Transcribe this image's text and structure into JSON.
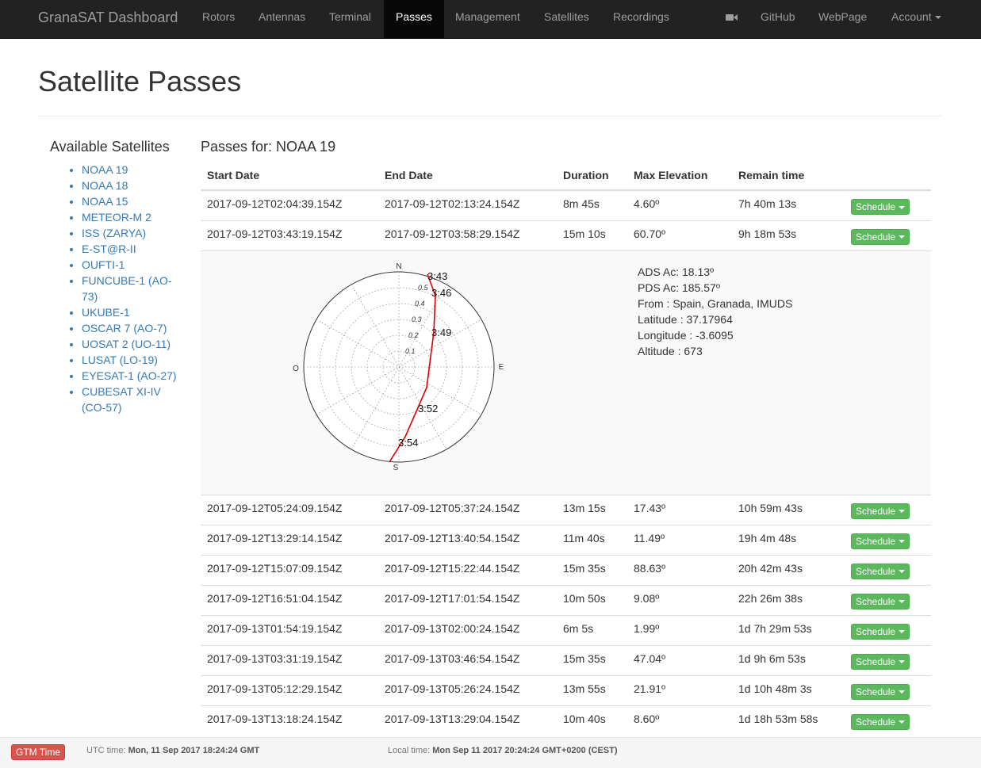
{
  "navbar": {
    "brand": "GranaSAT Dashboard",
    "items": [
      "Rotors",
      "Antennas",
      "Terminal",
      "Passes",
      "Management",
      "Satellites",
      "Recordings"
    ],
    "active": "Passes",
    "camera_icon": "video-camera-icon",
    "right_items": [
      "GitHub",
      "WebPage"
    ],
    "account": "Account"
  },
  "page": {
    "title": "Satellite Passes"
  },
  "sidebar": {
    "title": "Available Satellites",
    "satellites": [
      "NOAA 19",
      "NOAA 18",
      "NOAA 15",
      "METEOR-M 2",
      "ISS (ZARYA)",
      "E-ST@R-II",
      "OUFTI-1",
      "FUNCUBE-1 (AO-73)",
      "UKUBE-1",
      "OSCAR 7 (AO-7)",
      "UOSAT 2 (UO-11)",
      "LUSAT (LO-19)",
      "EYESAT-1 (AO-27)",
      "CUBESAT XI-IV (CO-57)"
    ]
  },
  "main": {
    "title": "Passes for: NOAA 19",
    "columns": [
      "Start Date",
      "End Date",
      "Duration",
      "Max Elevation",
      "Remain time"
    ],
    "schedule_label": "Schedule",
    "rows_before": [
      [
        "2017-09-12T02:04:39.154Z",
        "2017-09-12T02:13:24.154Z",
        "8m 45s",
        "4.60º",
        "7h 40m 13s"
      ],
      [
        "2017-09-12T03:43:19.154Z",
        "2017-09-12T03:58:29.154Z",
        "15m 10s",
        "60.70º",
        "9h 18m 53s"
      ]
    ],
    "rows_after": [
      [
        "2017-09-12T05:24:09.154Z",
        "2017-09-12T05:37:24.154Z",
        "13m 15s",
        "17.43º",
        "10h 59m 43s"
      ],
      [
        "2017-09-12T13:29:14.154Z",
        "2017-09-12T13:40:54.154Z",
        "11m 40s",
        "11.49º",
        "19h 4m 48s"
      ],
      [
        "2017-09-12T15:07:09.154Z",
        "2017-09-12T15:22:44.154Z",
        "15m 35s",
        "88.63º",
        "20h 42m 43s"
      ],
      [
        "2017-09-12T16:51:04.154Z",
        "2017-09-12T17:01:54.154Z",
        "10m 50s",
        "9.08º",
        "22h 26m 38s"
      ],
      [
        "2017-09-13T01:54:19.154Z",
        "2017-09-13T02:00:24.154Z",
        "6m 5s",
        "1.99º",
        "1d 7h 29m 53s"
      ],
      [
        "2017-09-13T03:31:19.154Z",
        "2017-09-13T03:46:54.154Z",
        "15m 35s",
        "47.04º",
        "1d 9h 6m 53s"
      ],
      [
        "2017-09-13T05:12:29.154Z",
        "2017-09-13T05:26:24.154Z",
        "13m 55s",
        "21.91º",
        "1d 10h 48m 3s"
      ],
      [
        "2017-09-13T13:18:24.154Z",
        "2017-09-13T13:29:04.154Z",
        "10m 40s",
        "8.60º",
        "1d 18h 53m 58s"
      ]
    ],
    "detail": {
      "info": [
        "ADS Ac: 18.13º",
        "PDS Ac: 185.57º",
        "From : Spain, Granada, IMUDS",
        "Latitude : 37.17964",
        "Longitude : -3.6095",
        "Altitude : 673"
      ],
      "polar": {
        "directions": {
          "north": "N",
          "south": "S",
          "east": "E",
          "west": "O"
        },
        "ring_labels": [
          "0.1",
          "0.2",
          "0.3",
          "0.4",
          "0.5"
        ],
        "track_color": "#e00000",
        "track_times": [
          "3:43",
          "3:46",
          "3:49",
          "3:52",
          "3:54"
        ]
      }
    }
  },
  "footer": {
    "gtm_button": "GTM Time",
    "utc_label": "UTC time:",
    "utc_value": "Mon, 11 Sep 2017 18:24:24 GMT",
    "local_label": "Local time:",
    "local_value": "Mon Sep 11 2017 20:24:24 GMT+0200 (CEST)"
  }
}
